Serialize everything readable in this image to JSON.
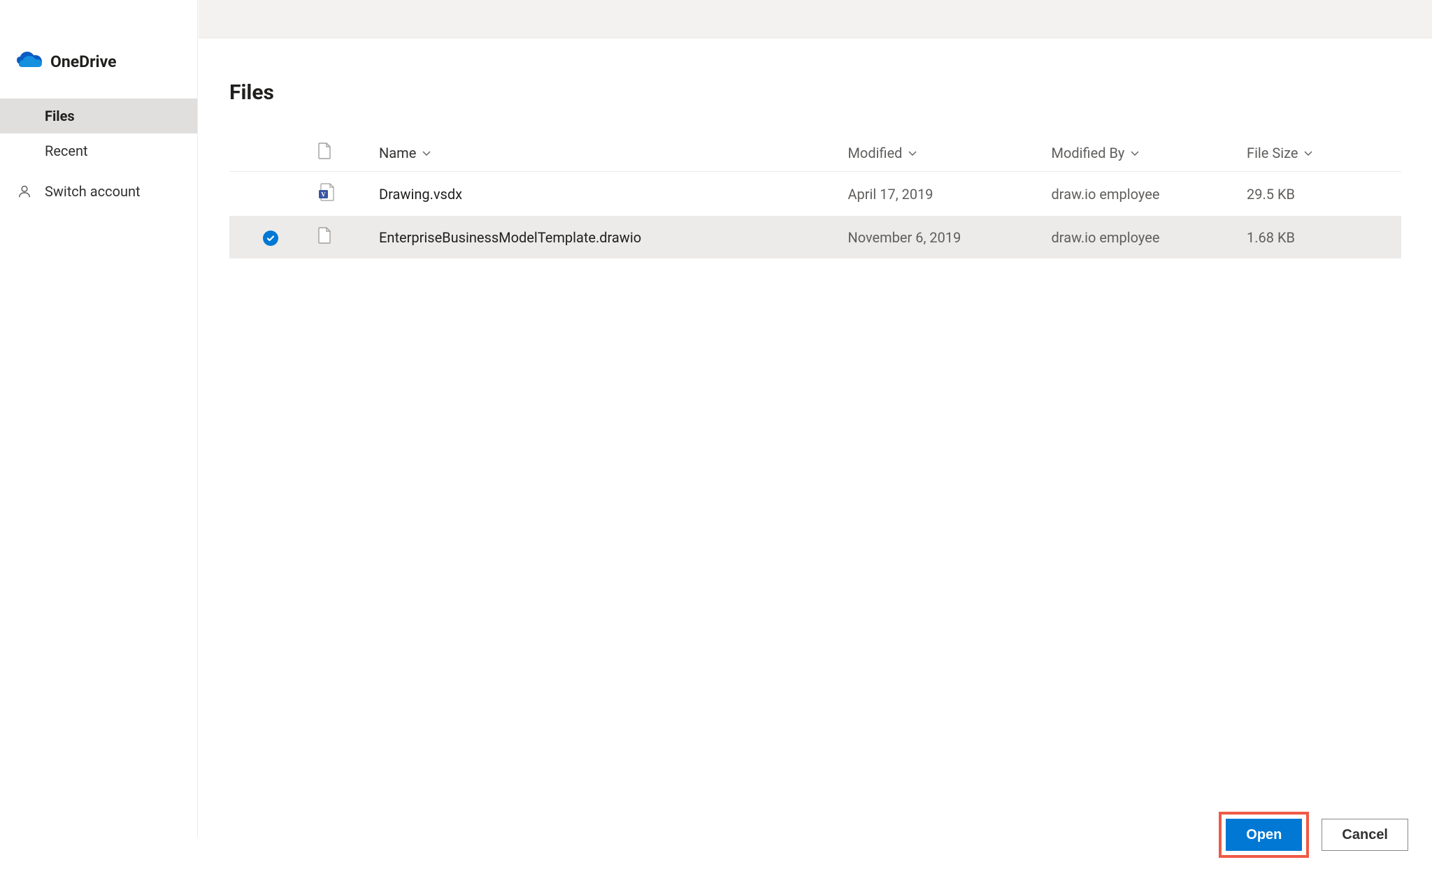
{
  "brand": {
    "name": "OneDrive"
  },
  "sidebar": {
    "items": [
      {
        "label": "Files",
        "active": true
      },
      {
        "label": "Recent",
        "active": false
      },
      {
        "label": "Switch account",
        "active": false
      }
    ]
  },
  "page_title": "Files",
  "columns": {
    "name": "Name",
    "modified": "Modified",
    "modified_by": "Modified By",
    "file_size": "File Size"
  },
  "files": [
    {
      "name": "Drawing.vsdx",
      "modified": "April 17, 2019",
      "modified_by": "draw.io employee",
      "size": "29.5 KB",
      "selected": false,
      "icon": "visio"
    },
    {
      "name": "EnterpriseBusinessModelTemplate.drawio",
      "modified": "November 6, 2019",
      "modified_by": "draw.io employee",
      "size": "1.68 KB",
      "selected": true,
      "icon": "generic"
    }
  ],
  "buttons": {
    "open": "Open",
    "cancel": "Cancel"
  }
}
